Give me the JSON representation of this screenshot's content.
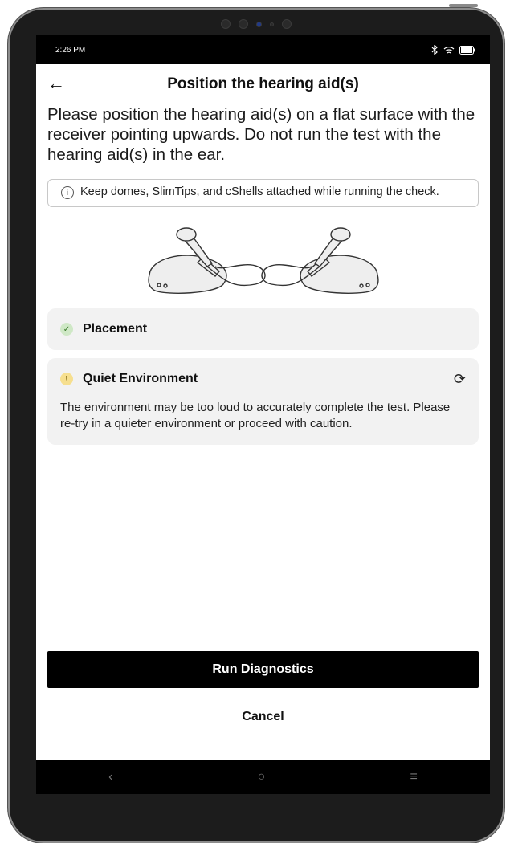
{
  "status": {
    "time": "2:26 PM"
  },
  "header": {
    "title": "Position the hearing aid(s)"
  },
  "intro": "Please position the hearing aid(s) on a flat surface with the receiver pointing upwards. Do not run the test with the hearing aid(s) in the ear.",
  "info": {
    "text": "Keep domes, SlimTips, and cShells attached while running the check."
  },
  "checks": [
    {
      "label": "Placement",
      "status": "passed",
      "icon": "check-icon",
      "color": "#cfe8c6"
    },
    {
      "label": "Quiet Environment",
      "status": "warning",
      "icon": "warning-icon",
      "color": "#f6df8f",
      "message": "The environment may be too loud to accurately complete the test. Please re-try in a quieter environment or proceed with caution."
    }
  ],
  "actions": {
    "primary": "Run Diagnostics",
    "secondary": "Cancel"
  }
}
